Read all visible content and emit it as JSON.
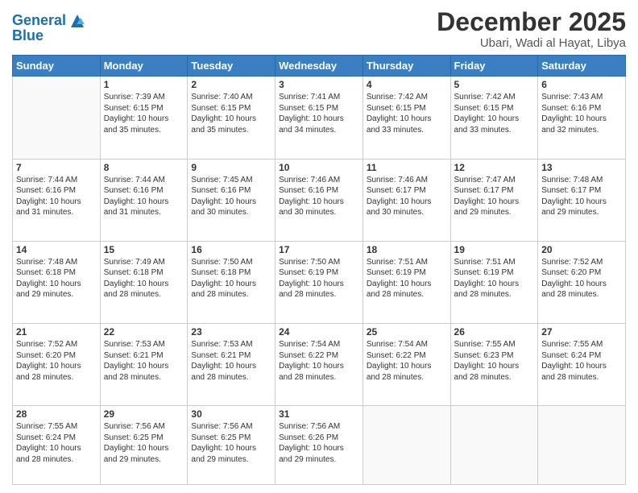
{
  "header": {
    "logo_line1": "General",
    "logo_line2": "Blue",
    "month": "December 2025",
    "location": "Ubari, Wadi al Hayat, Libya"
  },
  "days_of_week": [
    "Sunday",
    "Monday",
    "Tuesday",
    "Wednesday",
    "Thursday",
    "Friday",
    "Saturday"
  ],
  "weeks": [
    [
      {
        "day": "",
        "info": ""
      },
      {
        "day": "1",
        "info": "Sunrise: 7:39 AM\nSunset: 6:15 PM\nDaylight: 10 hours\nand 35 minutes."
      },
      {
        "day": "2",
        "info": "Sunrise: 7:40 AM\nSunset: 6:15 PM\nDaylight: 10 hours\nand 35 minutes."
      },
      {
        "day": "3",
        "info": "Sunrise: 7:41 AM\nSunset: 6:15 PM\nDaylight: 10 hours\nand 34 minutes."
      },
      {
        "day": "4",
        "info": "Sunrise: 7:42 AM\nSunset: 6:15 PM\nDaylight: 10 hours\nand 33 minutes."
      },
      {
        "day": "5",
        "info": "Sunrise: 7:42 AM\nSunset: 6:15 PM\nDaylight: 10 hours\nand 33 minutes."
      },
      {
        "day": "6",
        "info": "Sunrise: 7:43 AM\nSunset: 6:16 PM\nDaylight: 10 hours\nand 32 minutes."
      }
    ],
    [
      {
        "day": "7",
        "info": "Sunrise: 7:44 AM\nSunset: 6:16 PM\nDaylight: 10 hours\nand 31 minutes."
      },
      {
        "day": "8",
        "info": "Sunrise: 7:44 AM\nSunset: 6:16 PM\nDaylight: 10 hours\nand 31 minutes."
      },
      {
        "day": "9",
        "info": "Sunrise: 7:45 AM\nSunset: 6:16 PM\nDaylight: 10 hours\nand 30 minutes."
      },
      {
        "day": "10",
        "info": "Sunrise: 7:46 AM\nSunset: 6:16 PM\nDaylight: 10 hours\nand 30 minutes."
      },
      {
        "day": "11",
        "info": "Sunrise: 7:46 AM\nSunset: 6:17 PM\nDaylight: 10 hours\nand 30 minutes."
      },
      {
        "day": "12",
        "info": "Sunrise: 7:47 AM\nSunset: 6:17 PM\nDaylight: 10 hours\nand 29 minutes."
      },
      {
        "day": "13",
        "info": "Sunrise: 7:48 AM\nSunset: 6:17 PM\nDaylight: 10 hours\nand 29 minutes."
      }
    ],
    [
      {
        "day": "14",
        "info": "Sunrise: 7:48 AM\nSunset: 6:18 PM\nDaylight: 10 hours\nand 29 minutes."
      },
      {
        "day": "15",
        "info": "Sunrise: 7:49 AM\nSunset: 6:18 PM\nDaylight: 10 hours\nand 28 minutes."
      },
      {
        "day": "16",
        "info": "Sunrise: 7:50 AM\nSunset: 6:18 PM\nDaylight: 10 hours\nand 28 minutes."
      },
      {
        "day": "17",
        "info": "Sunrise: 7:50 AM\nSunset: 6:19 PM\nDaylight: 10 hours\nand 28 minutes."
      },
      {
        "day": "18",
        "info": "Sunrise: 7:51 AM\nSunset: 6:19 PM\nDaylight: 10 hours\nand 28 minutes."
      },
      {
        "day": "19",
        "info": "Sunrise: 7:51 AM\nSunset: 6:19 PM\nDaylight: 10 hours\nand 28 minutes."
      },
      {
        "day": "20",
        "info": "Sunrise: 7:52 AM\nSunset: 6:20 PM\nDaylight: 10 hours\nand 28 minutes."
      }
    ],
    [
      {
        "day": "21",
        "info": "Sunrise: 7:52 AM\nSunset: 6:20 PM\nDaylight: 10 hours\nand 28 minutes."
      },
      {
        "day": "22",
        "info": "Sunrise: 7:53 AM\nSunset: 6:21 PM\nDaylight: 10 hours\nand 28 minutes."
      },
      {
        "day": "23",
        "info": "Sunrise: 7:53 AM\nSunset: 6:21 PM\nDaylight: 10 hours\nand 28 minutes."
      },
      {
        "day": "24",
        "info": "Sunrise: 7:54 AM\nSunset: 6:22 PM\nDaylight: 10 hours\nand 28 minutes."
      },
      {
        "day": "25",
        "info": "Sunrise: 7:54 AM\nSunset: 6:22 PM\nDaylight: 10 hours\nand 28 minutes."
      },
      {
        "day": "26",
        "info": "Sunrise: 7:55 AM\nSunset: 6:23 PM\nDaylight: 10 hours\nand 28 minutes."
      },
      {
        "day": "27",
        "info": "Sunrise: 7:55 AM\nSunset: 6:24 PM\nDaylight: 10 hours\nand 28 minutes."
      }
    ],
    [
      {
        "day": "28",
        "info": "Sunrise: 7:55 AM\nSunset: 6:24 PM\nDaylight: 10 hours\nand 28 minutes."
      },
      {
        "day": "29",
        "info": "Sunrise: 7:56 AM\nSunset: 6:25 PM\nDaylight: 10 hours\nand 29 minutes."
      },
      {
        "day": "30",
        "info": "Sunrise: 7:56 AM\nSunset: 6:25 PM\nDaylight: 10 hours\nand 29 minutes."
      },
      {
        "day": "31",
        "info": "Sunrise: 7:56 AM\nSunset: 6:26 PM\nDaylight: 10 hours\nand 29 minutes."
      },
      {
        "day": "",
        "info": ""
      },
      {
        "day": "",
        "info": ""
      },
      {
        "day": "",
        "info": ""
      }
    ]
  ]
}
